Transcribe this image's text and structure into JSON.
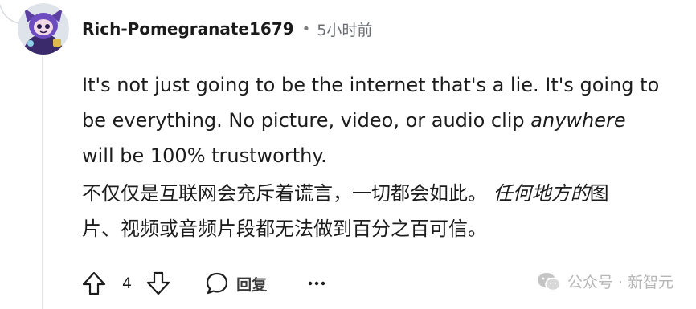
{
  "comment": {
    "username": "Rich-Pomegranate1679",
    "separator": "•",
    "timestamp": "5小时前",
    "body_en": {
      "line1_text": "It's not just going to be the internet that's a lie. It's going to be everything. No picture, video, or audio clip ",
      "emphasis": "anywhere",
      "line_end": " will be 100% trustworthy."
    },
    "body_zh": {
      "text": "不仅仅是互联网会充斥着谎言，一切都会如此。 ",
      "emphasis": "任何地方的",
      "text_end": "图片、视频或音频片段都无法做到百分之百可信。"
    }
  },
  "actions": {
    "vote_count": "4",
    "reply_label": "回复"
  },
  "icons": {
    "upvote": "upvote-arrow-icon",
    "downvote": "downvote-arrow-icon",
    "reply": "speech-bubble-icon",
    "more": "more-options-icon"
  },
  "watermark": {
    "text": "公众号 · 新智元"
  },
  "colors": {
    "text": "#1c1c1c",
    "muted": "#6a6e72",
    "watermark": "#b6b6b6",
    "thread_line": "#e3e6e8"
  }
}
